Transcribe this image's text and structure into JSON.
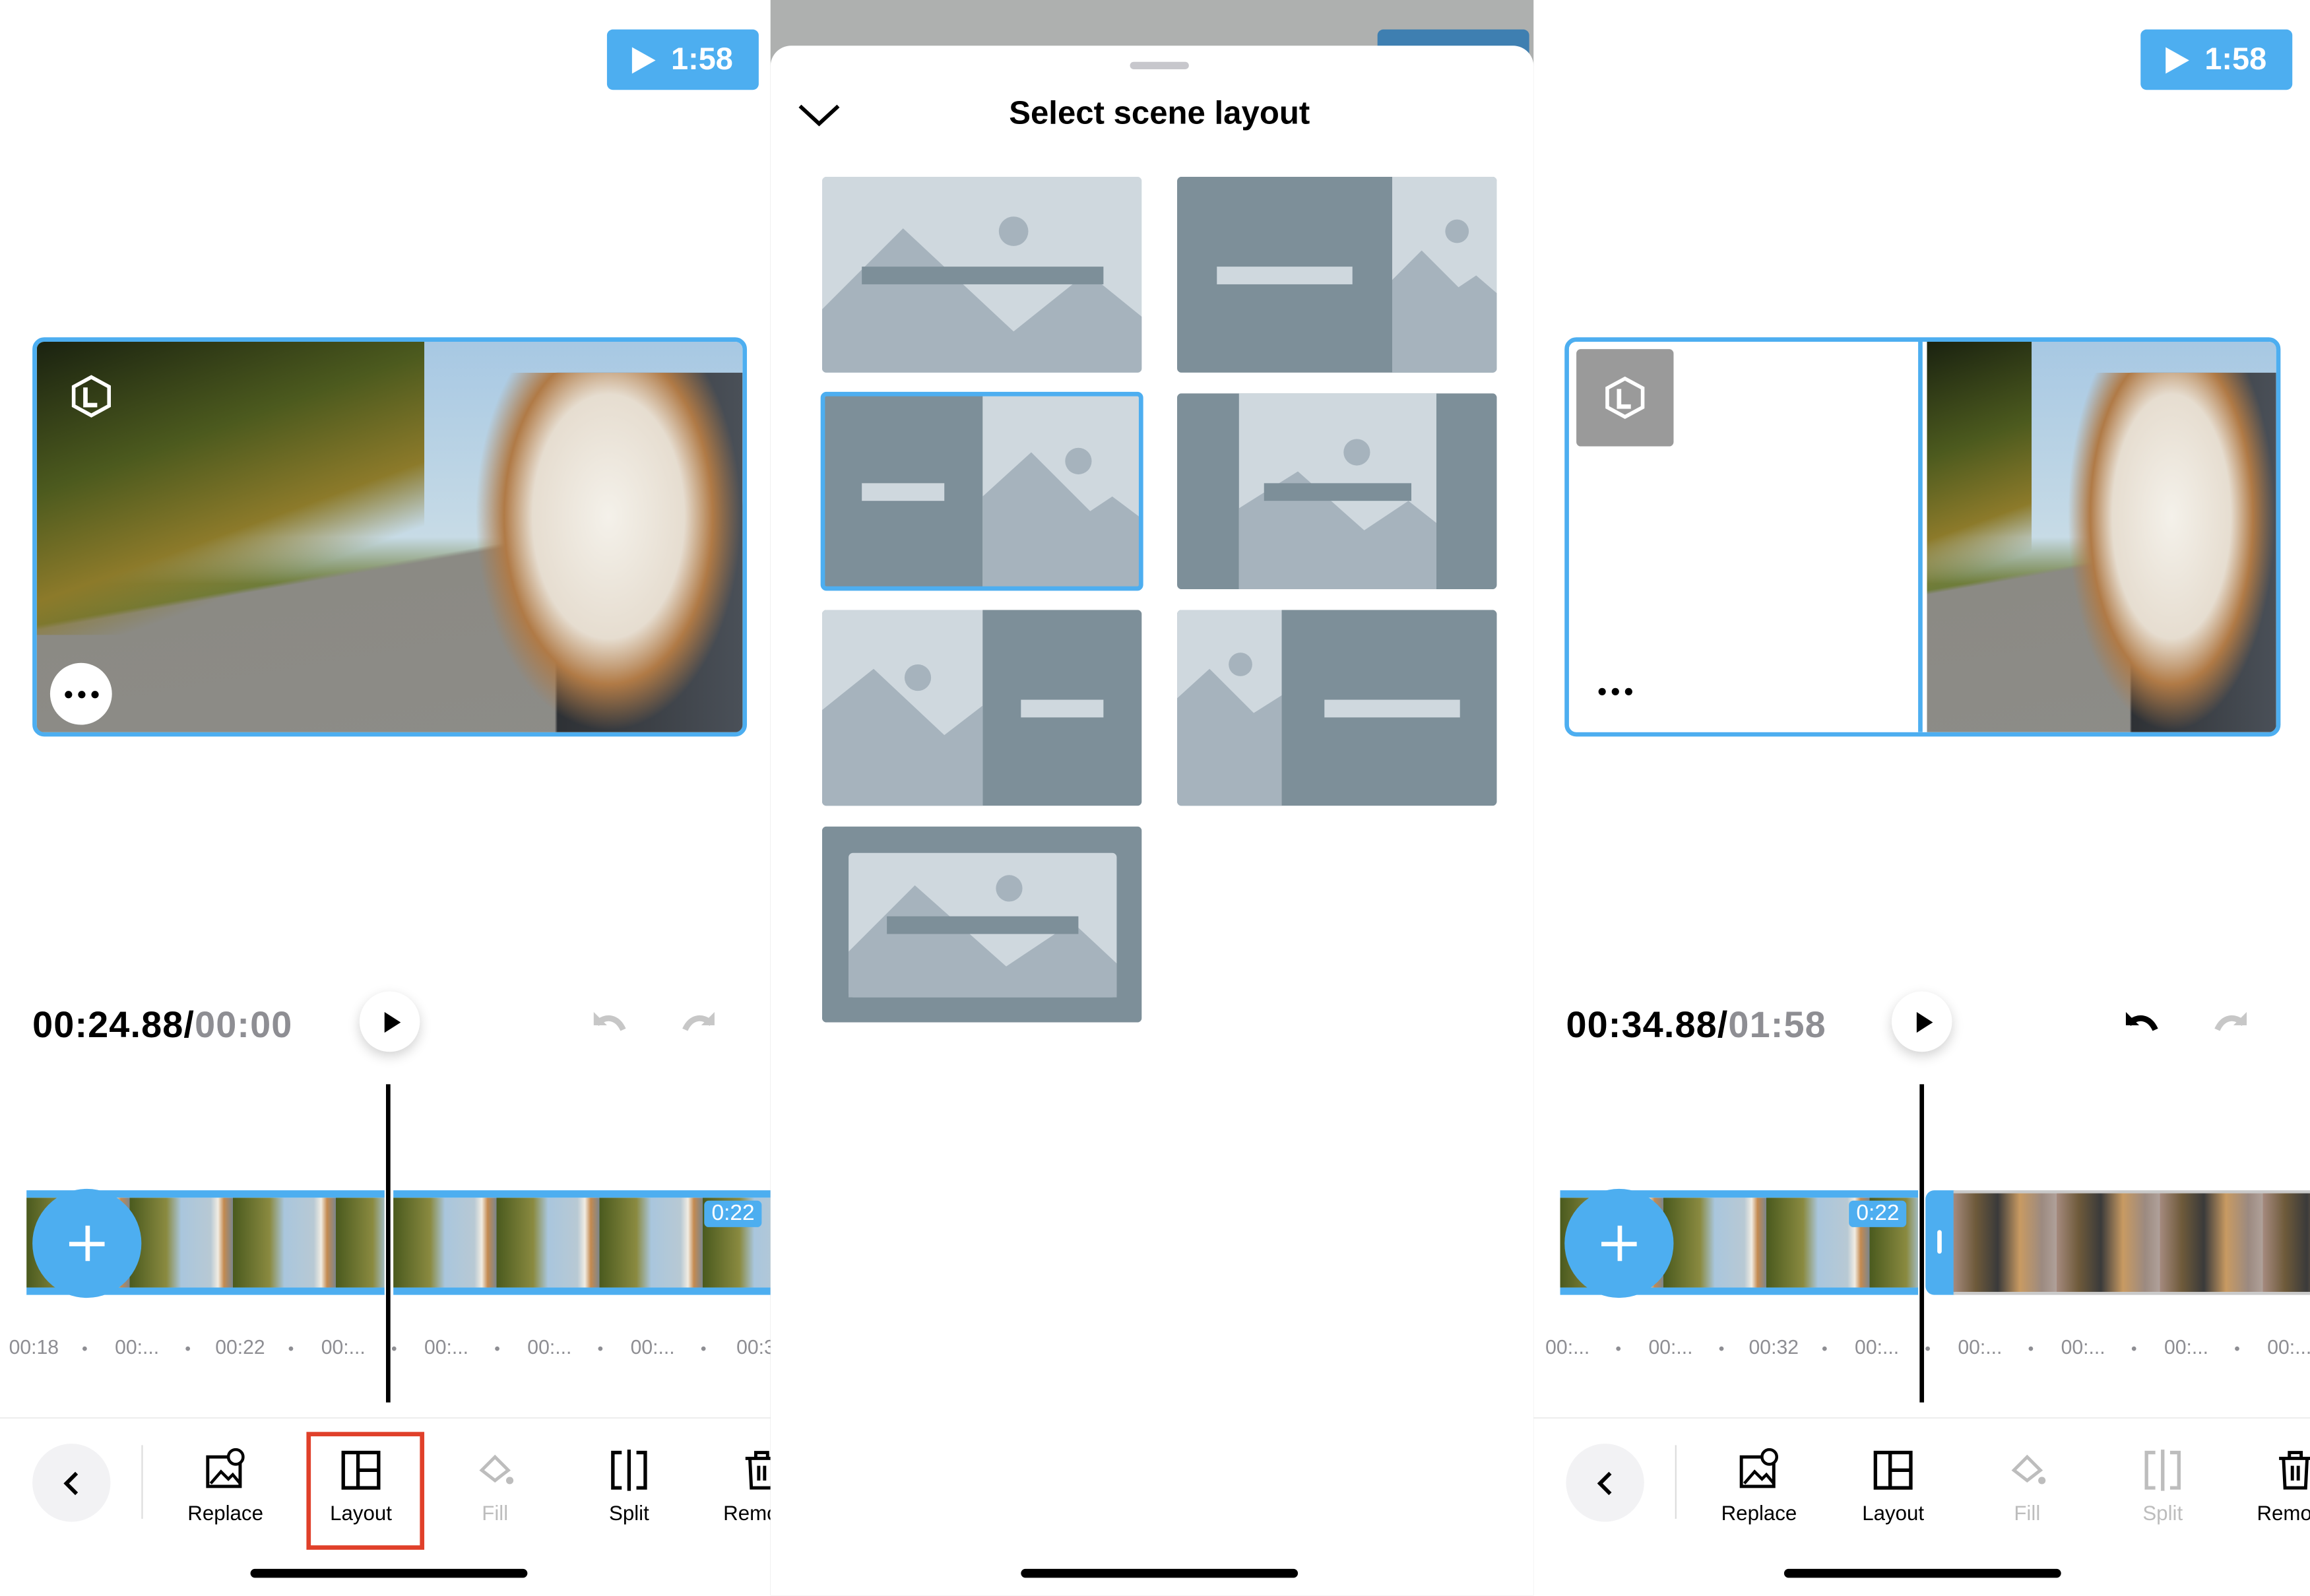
{
  "colors": {
    "accent": "#4daef0",
    "highlight": "#e0402a",
    "layout_dark": "#7d8f99",
    "layout_light": "#a6b3bd",
    "layout_bg": "#cfd8de"
  },
  "left": {
    "duration_badge": "1:58",
    "current_time": "00:24.88",
    "separator": "/",
    "total_time": "00:00",
    "clip_duration": "0:22",
    "ticks": [
      "00:18",
      "00:...",
      "00:22",
      "00:...",
      "00:...",
      "00:...",
      "00:...",
      "00:3"
    ],
    "undo_enabled": false,
    "redo_enabled": false,
    "toolbar": [
      {
        "label": "Replace",
        "icon": "replace-icon",
        "enabled": true
      },
      {
        "label": "Layout",
        "icon": "layout-icon",
        "enabled": true,
        "highlighted": true
      },
      {
        "label": "Fill",
        "icon": "fill-icon",
        "enabled": false
      },
      {
        "label": "Split",
        "icon": "split-icon",
        "enabled": true
      },
      {
        "label": "Remove",
        "icon": "trash-icon",
        "enabled": true
      }
    ]
  },
  "middle": {
    "title": "Select scene layout",
    "layouts": [
      {
        "name": "full-image-text",
        "selected": false
      },
      {
        "name": "text-left-image-right-narrow",
        "selected": false
      },
      {
        "name": "text-left-image-right-half",
        "selected": true
      },
      {
        "name": "image-center-bars",
        "selected": false
      },
      {
        "name": "image-left-text-right-half",
        "selected": false
      },
      {
        "name": "image-left-narrow-text-right",
        "selected": false
      },
      {
        "name": "framed-image",
        "selected": false
      }
    ]
  },
  "right": {
    "duration_badge": "1:58",
    "current_time": "00:34.88",
    "separator": "/",
    "total_time": "01:58",
    "clip_duration": "0:22",
    "ticks": [
      "00:...",
      "00:...",
      "00:32",
      "00:...",
      "00:...",
      "00:...",
      "00:...",
      "00:..."
    ],
    "undo_enabled": true,
    "redo_enabled": false,
    "toolbar": [
      {
        "label": "Replace",
        "icon": "replace-icon",
        "enabled": true
      },
      {
        "label": "Layout",
        "icon": "layout-icon",
        "enabled": true
      },
      {
        "label": "Fill",
        "icon": "fill-icon",
        "enabled": false
      },
      {
        "label": "Split",
        "icon": "split-icon",
        "enabled": false
      },
      {
        "label": "Remove",
        "icon": "trash-icon",
        "enabled": true
      }
    ]
  }
}
